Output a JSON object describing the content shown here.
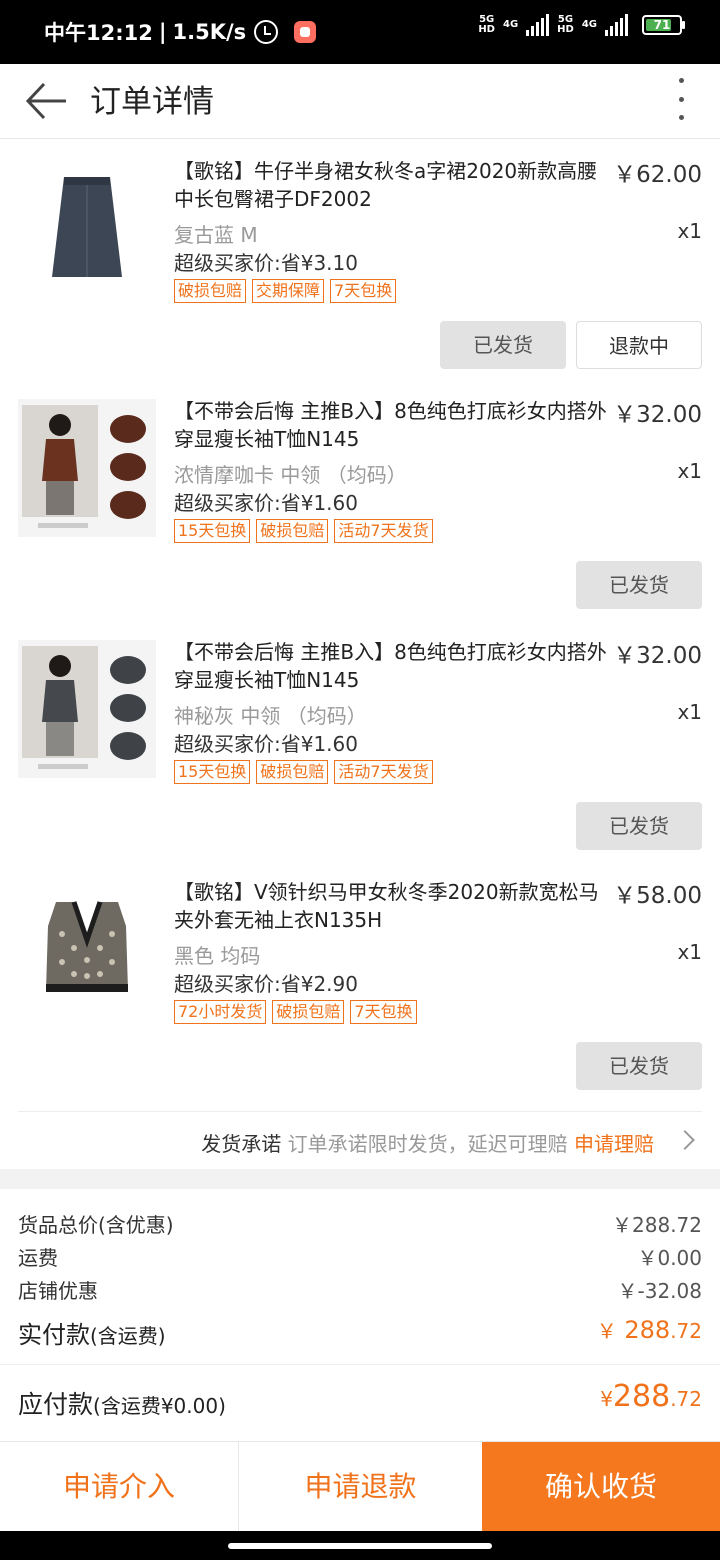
{
  "status_bar": {
    "time": "中午12:12",
    "separator": "|",
    "speed": "1.5K/s",
    "net1": "5G",
    "net1_sub": "HD",
    "net1_type": "4G",
    "net2": "5G",
    "net2_sub": "HD",
    "net2_type": "4G",
    "battery": "71"
  },
  "header": {
    "title": "订单详情"
  },
  "items": [
    {
      "title": "【歌铭】牛仔半身裙女秋冬a字裙2020新款高腰中长包臀裙子DF2002",
      "price": "￥62.00",
      "spec": "复古蓝 M",
      "qty": "x1",
      "save": "超级买家价:省¥3.10",
      "tags": [
        "破损包赔",
        "交期保障",
        "7天包换"
      ],
      "buttons": [
        "已发货",
        "退款中"
      ]
    },
    {
      "title": "【不带会后悔 主推B入】8色纯色打底衫女内搭外穿显瘦长袖T恤N145",
      "price": "￥32.00",
      "spec": "浓情摩咖卡 中领 （均码）",
      "qty": "x1",
      "save": "超级买家价:省¥1.60",
      "tags": [
        "15天包换",
        "破损包赔",
        "活动7天发货"
      ],
      "buttons": [
        "已发货"
      ]
    },
    {
      "title": "【不带会后悔 主推B入】8色纯色打底衫女内搭外穿显瘦长袖T恤N145",
      "price": "￥32.00",
      "spec": "神秘灰 中领 （均码）",
      "qty": "x1",
      "save": "超级买家价:省¥1.60",
      "tags": [
        "15天包换",
        "破损包赔",
        "活动7天发货"
      ],
      "buttons": [
        "已发货"
      ]
    },
    {
      "title": "【歌铭】V领针织马甲女秋冬季2020新款宽松马夹外套无袖上衣N135H",
      "price": "￥58.00",
      "spec": "黑色 均码",
      "qty": "x1",
      "save": "超级买家价:省¥2.90",
      "tags": [
        "72小时发货",
        "破损包赔",
        "7天包换"
      ],
      "buttons": [
        "已发货"
      ]
    }
  ],
  "promise": {
    "label": "发货承诺",
    "text": "订单承诺限时发货，延迟可理赔",
    "action": "申请理赔"
  },
  "summary": {
    "rows": [
      {
        "label": "货品总价(含优惠)",
        "value": "￥288.72"
      },
      {
        "label": "运费",
        "value": "￥0.00"
      },
      {
        "label": "店铺优惠",
        "value": "￥-32.08"
      }
    ],
    "paid_label": "实付款",
    "paid_label_note": "(含运费)",
    "paid_currency": "￥",
    "paid_int": "288",
    "paid_dec": ".72"
  },
  "payable": {
    "label": "应付款",
    "note": "(含运费¥0.00)",
    "currency": "¥",
    "int": "288",
    "dec": ".72"
  },
  "actions": {
    "intervene": "申请介入",
    "refund": "申请退款",
    "confirm": "确认收货"
  },
  "colors": {
    "accent": "#f5781e",
    "tag": "#f0731c"
  }
}
